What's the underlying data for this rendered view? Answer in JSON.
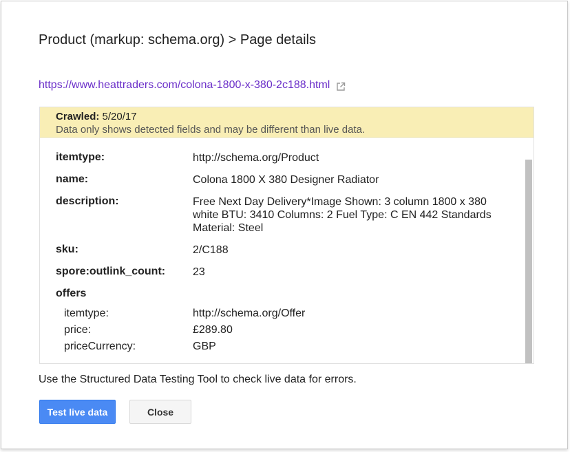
{
  "dialog": {
    "title": "Product (markup: schema.org) > Page details",
    "url": "https://www.heattraders.com/colona-1800-x-380-2c188.html",
    "notice": {
      "crawled_label": "Crawled:",
      "crawled_date": "5/20/17",
      "note": "Data only shows detected fields and may be different than live data."
    },
    "fields": [
      {
        "key": "itemtype:",
        "value": "http://schema.org/Product"
      },
      {
        "key": "name:",
        "value": "Colona 1800 X 380 Designer Radiator"
      },
      {
        "key": "description:",
        "value": "Free Next Day Delivery*Image Shown: 3 column 1800 x 380 white BTU: 3410 Columns: 2 Fuel Type: C EN 442 Standards Material: Steel"
      },
      {
        "key": "sku:",
        "value": "2/C188"
      },
      {
        "key": "spore:outlink_count:",
        "value": "23"
      }
    ],
    "offers": {
      "label": "offers",
      "fields": [
        {
          "key": "itemtype:",
          "value": "http://schema.org/Offer"
        },
        {
          "key": "price:",
          "value": "£289.80"
        },
        {
          "key": "priceCurrency:",
          "value": "GBP"
        }
      ]
    },
    "footer_text": "Use the Structured Data Testing Tool to check live data for errors.",
    "buttons": {
      "test_live": "Test live data",
      "close": "Close"
    },
    "icons": {
      "external_link": "external-link-icon"
    },
    "colors": {
      "link": "#6b2fc9",
      "notice_bg": "#f9eeb5",
      "primary_button": "#4a8af4"
    }
  }
}
